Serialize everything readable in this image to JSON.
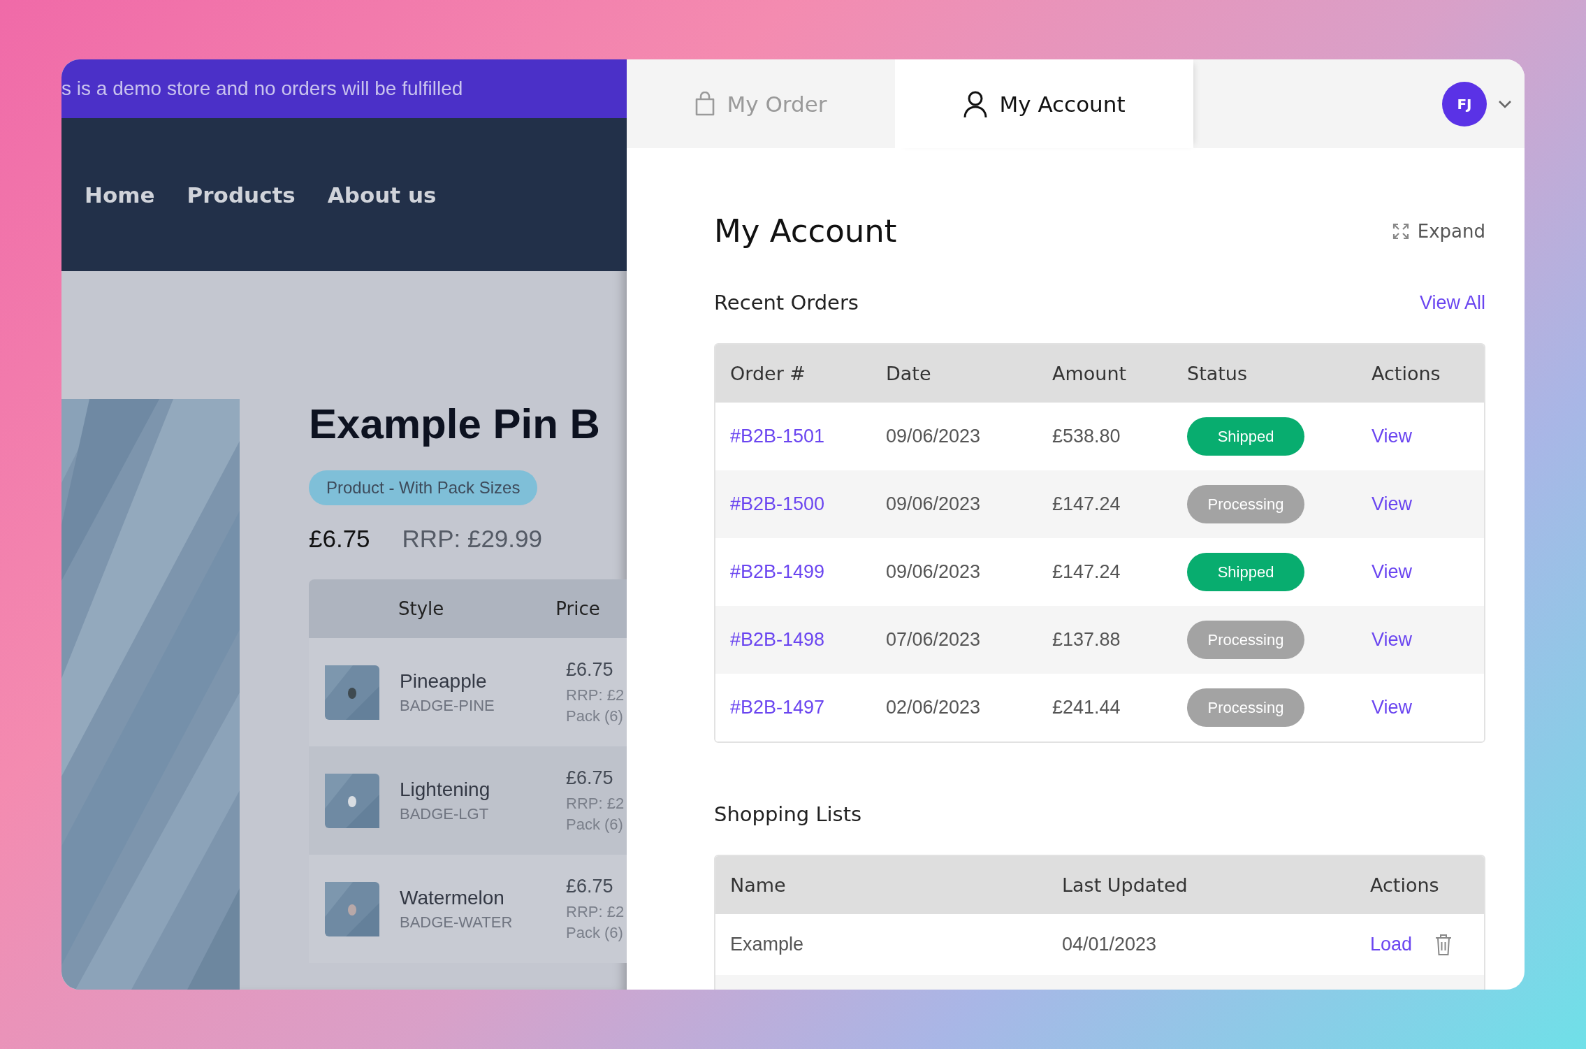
{
  "store": {
    "banner": "s is a demo store and no orders will be fulfilled",
    "nav": [
      {
        "label": "Home"
      },
      {
        "label": "Products"
      },
      {
        "label": "About us"
      }
    ],
    "product": {
      "title": "Example Pin B",
      "tag": "Product - With Pack Sizes",
      "price": "£6.75",
      "rrp": "RRP: £29.99",
      "variants": {
        "columns": [
          "Style",
          "Price"
        ],
        "rows": [
          {
            "name": "Pineapple",
            "sku": "BADGE-PINE",
            "price": "£6.75",
            "rrp": "RRP: £2",
            "pack": "Pack (6)"
          },
          {
            "name": "Lightening",
            "sku": "BADGE-LGT",
            "price": "£6.75",
            "rrp": "RRP: £2",
            "pack": "Pack (6)"
          },
          {
            "name": "Watermelon",
            "sku": "BADGE-WATER",
            "price": "£6.75",
            "rrp": "RRP: £2",
            "pack": "Pack (6)"
          }
        ]
      }
    }
  },
  "tabs": [
    {
      "label": "My Order",
      "kind": "bag",
      "selected": false
    },
    {
      "label": "My Account",
      "kind": "person",
      "selected": true
    }
  ],
  "avatar": {
    "initials": "FJ"
  },
  "account": {
    "title": "My Account",
    "expand": "Expand",
    "recent_orders": {
      "title": "Recent Orders",
      "view_all": "View All",
      "columns": [
        "Order #",
        "Date",
        "Amount",
        "Status",
        "Actions"
      ],
      "rows": [
        {
          "order": "#B2B-1501",
          "date": "09/06/2023",
          "amount": "£538.80",
          "status": "Shipped",
          "kind": "shipped",
          "action": "View"
        },
        {
          "order": "#B2B-1500",
          "date": "09/06/2023",
          "amount": "£147.24",
          "status": "Processing",
          "kind": "processing",
          "action": "View"
        },
        {
          "order": "#B2B-1499",
          "date": "09/06/2023",
          "amount": "£147.24",
          "status": "Shipped",
          "kind": "shipped",
          "action": "View"
        },
        {
          "order": "#B2B-1498",
          "date": "07/06/2023",
          "amount": "£137.88",
          "status": "Processing",
          "kind": "processing",
          "action": "View"
        },
        {
          "order": "#B2B-1497",
          "date": "02/06/2023",
          "amount": "£241.44",
          "status": "Processing",
          "kind": "processing",
          "action": "View"
        }
      ]
    },
    "shopping_lists": {
      "title": "Shopping Lists",
      "columns": [
        "Name",
        "Last Updated",
        "Actions"
      ],
      "rows": [
        {
          "name": "Example",
          "updated": "04/01/2023",
          "action": "Load"
        }
      ]
    }
  }
}
